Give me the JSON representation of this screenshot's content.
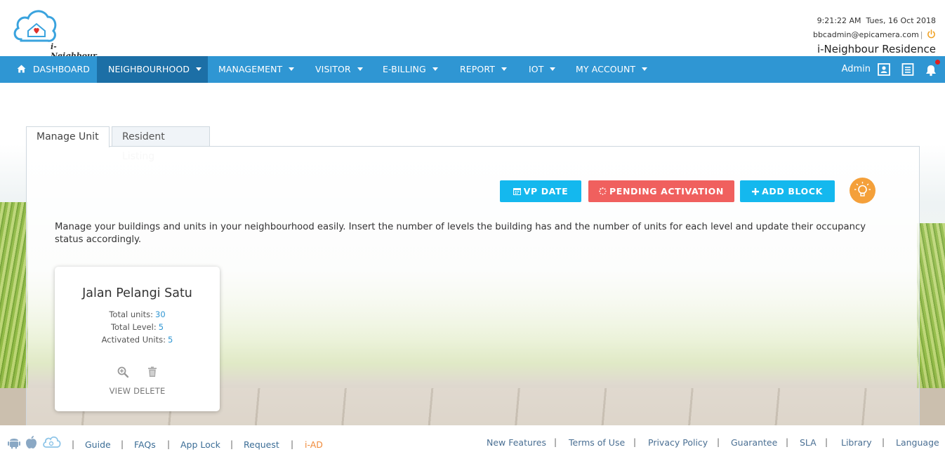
{
  "header": {
    "logo_text": "i-Neighbour",
    "time": "9:21:22 AM",
    "date": "Tues, 16 Oct 2018",
    "email": "bbcadmin@epicamera.com",
    "separator": "|",
    "residence": "i-Neighbour Residence"
  },
  "nav": {
    "items": [
      {
        "label": "DASHBOARD",
        "icon": "home-icon",
        "dropdown": false
      },
      {
        "label": "NEIGHBOURHOOD",
        "dropdown": true,
        "active": true
      },
      {
        "label": "MANAGEMENT",
        "dropdown": true
      },
      {
        "label": "VISITOR",
        "dropdown": true
      },
      {
        "label": "E-BILLING",
        "dropdown": true
      },
      {
        "label": "REPORT",
        "dropdown": true
      },
      {
        "label": "IOT",
        "dropdown": true
      },
      {
        "label": "MY ACCOUNT",
        "dropdown": true
      }
    ],
    "user_label": "Admin",
    "right_icons": [
      "contact-card-icon",
      "document-list-icon",
      "notification-bell-icon"
    ]
  },
  "tabs": [
    {
      "label": "Manage Unit",
      "active": true
    },
    {
      "label": "Resident Listing",
      "active": false
    }
  ],
  "actions": {
    "vp_date": "VP DATE",
    "pending_activation": "PENDING ACTIVATION",
    "add_block": "ADD BLOCK",
    "tip_icon": "lightbulb-icon"
  },
  "description": "Manage your buildings and units in your neighbourhood easily. Insert the number of levels the building has and the number of units for each level and update their occupancy status accordingly.",
  "blocks": [
    {
      "name": "Jalan Pelangi Satu",
      "total_units_label": "Total units:",
      "total_units": "30",
      "total_level_label": "Total Level:",
      "total_level": "5",
      "activated_units_label": "Activated Units:",
      "activated_units": "5",
      "view_label": "VIEW",
      "delete_label": "DELETE"
    }
  ],
  "footer": {
    "app_icons": [
      "android-icon",
      "apple-icon",
      "cloud-app-icon"
    ],
    "separator": "|",
    "left_links": [
      "Guide",
      "FAQs",
      "App Lock",
      "Request",
      "i-AD"
    ],
    "right_links": [
      "New Features",
      "Terms of Use",
      "Privacy Policy",
      "Guarantee",
      "SLA",
      "Library",
      "Language"
    ]
  },
  "colors": {
    "nav_bg": "#2f96d3",
    "nav_active": "#1c6fa6",
    "button_blue": "#14b8ee",
    "button_red": "#f0605e",
    "tip_orange": "#f4a03a",
    "link_accent": "#f08a3a"
  }
}
